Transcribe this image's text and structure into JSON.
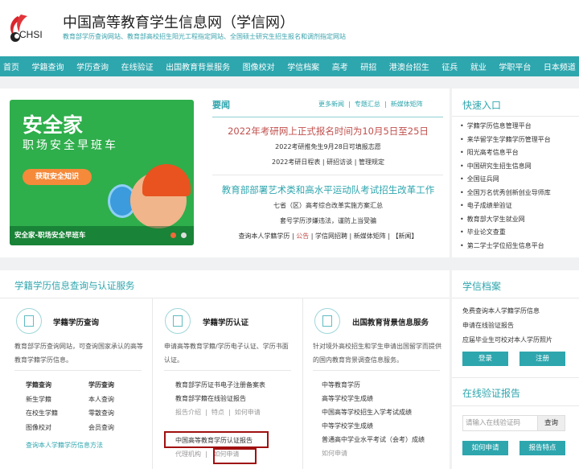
{
  "header": {
    "logo_text": "CHSI",
    "title": "中国高等教育学生信息网（学信网）",
    "subtitle": "教育部学历查询网站、教育部高校招生阳光工程指定网站、全国硕士研究生招生报名和调剂指定网站"
  },
  "nav": [
    "首页",
    "学籍查询",
    "学历查询",
    "在线验证",
    "出国教育背景服务",
    "图像校对",
    "学信档案",
    "高考",
    "研招",
    "港澳台招生",
    "征兵",
    "就业",
    "学职平台",
    "日本频道"
  ],
  "banner": {
    "title": "安全家",
    "subtitle": "职场安全早班车",
    "button": "获取安全知识",
    "caption": "安全家-职场安全早班车"
  },
  "news": {
    "heading": "要闻",
    "links": [
      "更多新闻",
      "专题汇总",
      "新媒体矩阵"
    ],
    "headline1": "2022年考研网上正式报名时间为10月5日至25日",
    "line1": "2022考研推免生9月28日可填报志愿",
    "line2": [
      "2022考研日程表",
      "研招访谈",
      "管理规定"
    ],
    "headline2": "教育部部署艺术类和高水平运动队考试招生改革工作",
    "line3": "七省（区）高考综合改革实施方案汇总",
    "line4": "套号学历涉嫌违法，谨防上当受骗",
    "line5": [
      "查询本人学籍学历",
      "公告",
      "学信网招聘",
      "新媒体矩阵",
      "【新闻】"
    ]
  },
  "quick": {
    "heading": "快速入口",
    "items": [
      "学籍学历信息管理平台",
      "来华留学生学籍学历管理平台",
      "阳光高考信息平台",
      "中国研究生招生信息网",
      "全国征兵网",
      "全国万名优秀创新创业导师库",
      "电子成绩单验证",
      "教育部大学生就业网",
      "毕业论文查重",
      "第二学士学位招生信息平台"
    ]
  },
  "services": {
    "title": "学籍学历信息查询与认证服务",
    "col1": {
      "title": "学籍学历查询",
      "desc": "教育部学历查询网站，可查询国家承认的高等教育学籍学历信息。",
      "left": [
        "学籍查询",
        "新生学籍",
        "在校生学籍",
        "图像校对"
      ],
      "right": [
        "学历查询",
        "本人查询",
        "零散查询",
        "会员查询"
      ],
      "link": "查询本人学籍学历信息方法"
    },
    "col2": {
      "title": "学籍学历认证",
      "desc": "申请高等教育学籍/学历电子认证、学历书面认证。",
      "items": [
        "教育部学历证书电子注册备案表",
        "教育部学籍在线验证报告"
      ],
      "sub": [
        "报告介绍",
        "特点",
        "如何申请"
      ],
      "report": "中国高等教育学历认证报告",
      "sub2": [
        "代理机构",
        "如何申请"
      ]
    },
    "col3": {
      "title": "出国教育背景信息服务",
      "desc": "针对境外高校招生和学生申请出国留学而提供的国内教育背景调查信息服务。",
      "items": [
        "中等教育学历",
        "高等学校学生成绩",
        "中国高等学校招生入学考试成绩",
        "中等学校学生成绩",
        "普通高中学业水平考试（会考）成绩"
      ],
      "link": "如何申请"
    }
  },
  "archive": {
    "heading": "学信档案",
    "items": [
      "免费查询本人学籍学历信息",
      "申请在线验证报告",
      "应届毕业生可校对本人学历照片"
    ],
    "login": "登录",
    "register": "注册"
  },
  "verify": {
    "heading": "在线验证报告",
    "placeholder": "请输入在线验证码",
    "query": "查询",
    "how": "如何申请",
    "features": "报告特点"
  }
}
